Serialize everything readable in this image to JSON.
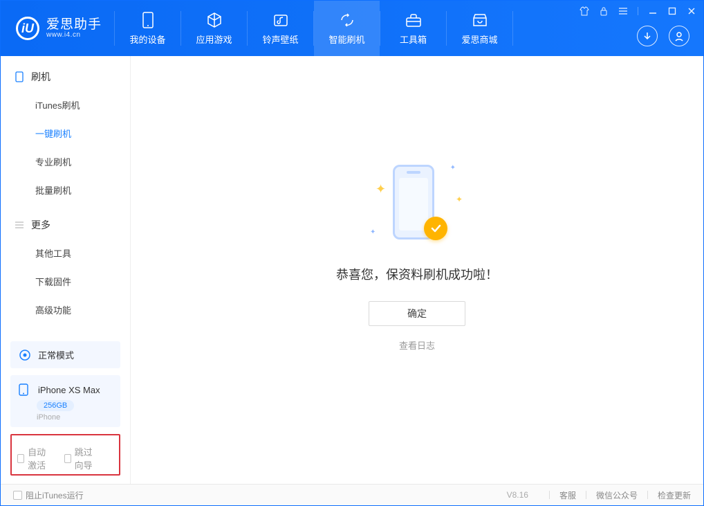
{
  "app": {
    "name_cn": "爱思助手",
    "url": "www.i4.cn"
  },
  "nav": {
    "items": [
      {
        "label": "我的设备"
      },
      {
        "label": "应用游戏"
      },
      {
        "label": "铃声壁纸"
      },
      {
        "label": "智能刷机"
      },
      {
        "label": "工具箱"
      },
      {
        "label": "爱思商城"
      }
    ],
    "active_index": 3
  },
  "sidebar": {
    "group1": {
      "title": "刷机",
      "items": [
        {
          "label": "iTunes刷机"
        },
        {
          "label": "一键刷机"
        },
        {
          "label": "专业刷机"
        },
        {
          "label": "批量刷机"
        }
      ],
      "active_index": 1
    },
    "group2": {
      "title": "更多",
      "items": [
        {
          "label": "其他工具"
        },
        {
          "label": "下载固件"
        },
        {
          "label": "高级功能"
        }
      ]
    },
    "mode": "正常模式",
    "device": {
      "name": "iPhone XS Max",
      "storage": "256GB",
      "type": "iPhone"
    },
    "options": {
      "auto_activate": "自动激活",
      "skip_guide": "跳过向导"
    }
  },
  "main": {
    "success": "恭喜您，保资料刷机成功啦！",
    "confirm": "确定",
    "view_log": "查看日志"
  },
  "footer": {
    "block_itunes": "阻止iTunes运行",
    "version": "V8.16",
    "support": "客服",
    "wechat": "微信公众号",
    "check_update": "检查更新"
  }
}
